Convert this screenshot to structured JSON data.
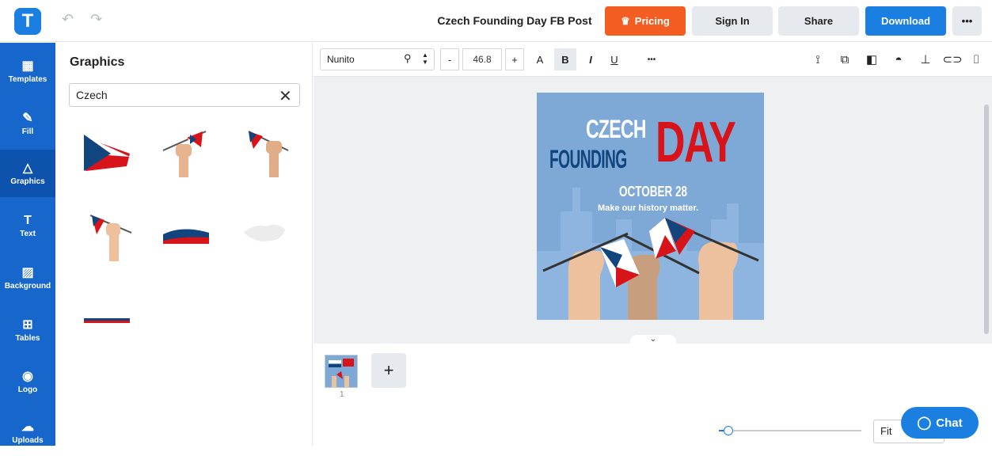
{
  "app": {
    "logo_letter": "T"
  },
  "topbar": {
    "undo_icon": "↶",
    "redo_icon": "↷",
    "title": "Czech Founding Day FB Post",
    "pricing": "Pricing",
    "pricing_icon": "♛",
    "signin": "Sign In",
    "share": "Share",
    "download": "Download",
    "more": "•••"
  },
  "sidebar": {
    "items": [
      {
        "label": "Templates",
        "icon": "▦"
      },
      {
        "label": "Fill",
        "icon": "✎"
      },
      {
        "label": "Graphics",
        "icon": "△"
      },
      {
        "label": "Text",
        "icon": "T"
      },
      {
        "label": "Background",
        "icon": "▨"
      },
      {
        "label": "Tables",
        "icon": "⊞"
      },
      {
        "label": "Logo",
        "icon": "◉"
      },
      {
        "label": "Uploads",
        "icon": "☁"
      }
    ]
  },
  "panel": {
    "title": "Graphics",
    "search_value": "Czech",
    "clear_icon": "✕",
    "collapse_icon": "‹"
  },
  "format_bar": {
    "font": "Nunito",
    "minus": "-",
    "size": "46.8",
    "plus": "+",
    "case": "A",
    "bold": "B",
    "italic": "I",
    "underline": "U",
    "more": "•••"
  },
  "design": {
    "line1": "CZECH",
    "line2": "FOUNDING",
    "line3": "DAY",
    "date": "OCTOBER 28",
    "tagline": "Make our history matter."
  },
  "pages": {
    "page_number": "1",
    "add": "+"
  },
  "bottom": {
    "zoom": "Fit",
    "chat": "Chat",
    "chat_icon": "◯"
  },
  "colors": {
    "brand": "#1a7fe0",
    "pricing": "#f45d22",
    "sidebar": "#1666cc",
    "red": "#d7141a",
    "blue": "#11457e"
  }
}
